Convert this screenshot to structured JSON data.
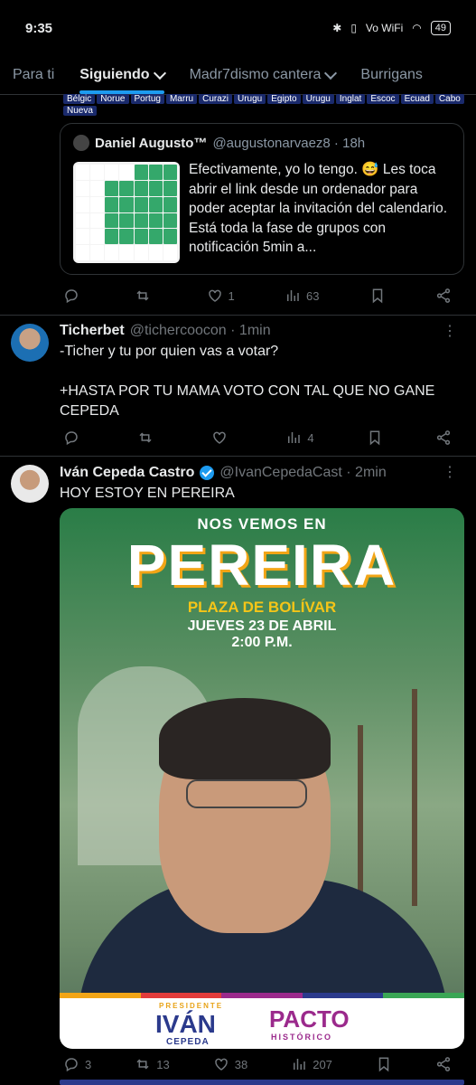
{
  "status": {
    "time": "9:35",
    "network": "Vo WiFi",
    "battery": "49"
  },
  "tabs": [
    {
      "label": "Para ti"
    },
    {
      "label": "Siguiendo"
    },
    {
      "label": "Madr7dismo cantera"
    },
    {
      "label": "Burrigans"
    }
  ],
  "flags": [
    "Bélgic",
    "Norue",
    "Portug",
    "Marru",
    "Curazi",
    "Urugu",
    "Egipto",
    "Urugu",
    "Inglat",
    "Escoc",
    "Ecuad",
    "Cabo",
    "Nueva"
  ],
  "quote": {
    "name": "Daniel Augusto™",
    "meta": "@augustonarvaez8 · 18h",
    "text": "Efectivamente, yo lo tengo. 😅 Les toca abrir el link desde un ordenador para poder aceptar la invitación del calendario. Está toda la fase de grupos con notificación 5min a..."
  },
  "actions1": {
    "replies": "",
    "reposts": "",
    "likes": "1",
    "views": "63"
  },
  "post2": {
    "name": "Ticherbet",
    "meta": "@tichercoocon · 1min",
    "line1": "-Ticher y tu por quien vas a votar?",
    "line2": "+HASTA POR TU MAMA VOTO CON TAL QUE NO GANE CEPEDA"
  },
  "actions2": {
    "replies": "",
    "reposts": "",
    "likes": "",
    "views": "4"
  },
  "post3": {
    "name": "Iván Cepeda Castro",
    "meta": "@IvanCepedaCast · 2min",
    "text": "HOY ESTOY EN PEREIRA"
  },
  "poster": {
    "line1": "NOS VEMOS EN",
    "line2": "PEREIRA",
    "line3": "PLAZA DE BOLÍVAR",
    "line4": "JUEVES 23 DE ABRIL",
    "line5": "2:00 P.M.",
    "footer_label": "PRESIDENTE",
    "footer_name1": "IVÁN",
    "footer_name2": "CEPEDA",
    "party": "PACTO",
    "party_sub": "HISTÓRICO"
  },
  "actions3": {
    "replies": "3",
    "reposts": "13",
    "likes": "38",
    "views": "207"
  },
  "colors": {
    "accent": "#1d9bf0",
    "background": "#000000",
    "muted": "#71767b"
  }
}
